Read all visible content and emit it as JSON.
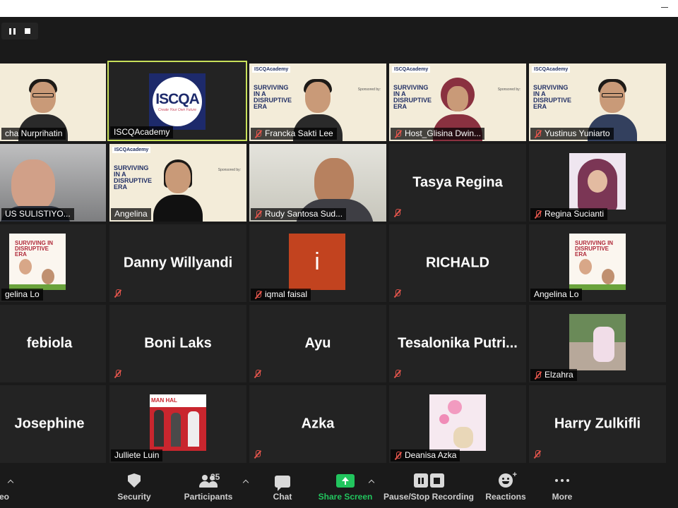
{
  "window": {
    "title": ""
  },
  "participants": [
    {
      "name": "cha Nurprihatin",
      "muted": false
    },
    {
      "name": "ISCQAcademy",
      "muted": false,
      "logo_text": "ISCQA",
      "logo_tagline": "Create Your Own Future"
    },
    {
      "name": "Francka Sakti Lee",
      "muted": true
    },
    {
      "name": "Host_Glisina Dwin...",
      "muted": true
    },
    {
      "name": "Yustinus Yuniarto",
      "muted": true
    },
    {
      "name": "US SULISTIYO...",
      "muted": false
    },
    {
      "name": "Angelina",
      "muted": false
    },
    {
      "name": "Rudy Santosa Sud...",
      "muted": true
    },
    {
      "name": "Tasya Regina",
      "muted": true
    },
    {
      "name": "Regina Sucianti",
      "muted": true
    },
    {
      "name": "gelina Lo",
      "muted": false
    },
    {
      "name": "Danny Willyandi",
      "muted": true
    },
    {
      "name": "iqmal faisal",
      "muted": true,
      "avatar_letter": "i"
    },
    {
      "name": "RICHALD",
      "muted": true
    },
    {
      "name": "Angelina Lo",
      "muted": false
    },
    {
      "name": "febiola",
      "muted": false
    },
    {
      "name": "Boni Laks",
      "muted": true
    },
    {
      "name": "Ayu",
      "muted": true
    },
    {
      "name": "Tesalonika  Putri...",
      "muted": true
    },
    {
      "name": "Elzahra",
      "muted": true
    },
    {
      "name": "Josephine",
      "muted": false
    },
    {
      "name": "Julliete Luin",
      "muted": false
    },
    {
      "name": "Azka",
      "muted": true
    },
    {
      "name": "Deanisa Azka",
      "muted": true
    },
    {
      "name": "Harry Zulkifli",
      "muted": true
    }
  ],
  "slide": {
    "logo": "ISCQAcademy",
    "title": "SURVIVING IN A DISRUPTIVE ERA",
    "sponsor": "Sponsored by:"
  },
  "poster": {
    "title": "SURVIVING IN DISRUPTIVE ERA"
  },
  "photo_red": {
    "banner": "MAN  HAL"
  },
  "toolbar": {
    "video_label": "eo",
    "security_label": "Security",
    "participants_label": "Participants",
    "participants_count": "25",
    "chat_label": "Chat",
    "share_label": "Share Screen",
    "record_label": "Pause/Stop Recording",
    "reactions_label": "Reactions",
    "more_label": "More"
  },
  "colors": {
    "active_speaker": "#c8e05a",
    "share_green": "#22c55e",
    "muted_red": "#e0544b",
    "background": "#1a1a1a"
  }
}
